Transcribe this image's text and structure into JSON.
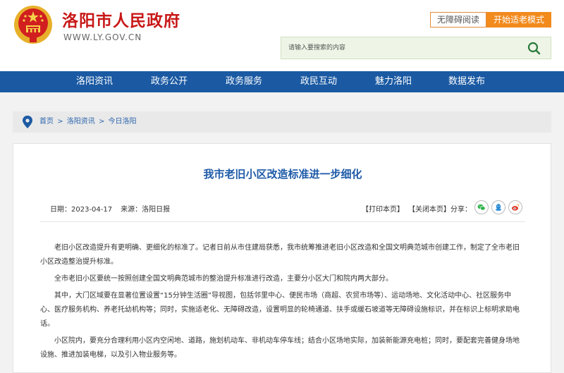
{
  "header": {
    "site_title": "洛阳市人民政府",
    "site_url": "WWW.LY.GOV.CN",
    "accessible_btn": "无障碍阅读",
    "elder_btn": "开始适老模式",
    "search_placeholder": "请输入要搜索的内容"
  },
  "nav": {
    "items": [
      "洛阳资讯",
      "政务公开",
      "政务服务",
      "政民互动",
      "魅力洛阳",
      "数据发布"
    ]
  },
  "breadcrumb": {
    "items": [
      "首页",
      "洛阳资讯",
      "今日洛阳"
    ],
    "separator": ">"
  },
  "article": {
    "title": "我市老旧小区改造标准进一步细化",
    "date": "日期：2023-04-17",
    "source": "来源：洛阳日报",
    "print": "【打印本页】",
    "close": "【关闭本页】",
    "share_label": "分享：",
    "paragraphs": [
      "老旧小区改造提升有更明确、更细化的标准了。记者日前从市住建局获悉，我市统筹推进老旧小区改造和全国文明典范城市创建工作，制定了全市老旧小区改造整治提升标准。",
      "全市老旧小区要统一按照创建全国文明典范城市的整治提升标准进行改造，主要分小区大门和院内两大部分。",
      "其中，大门区域要在显著位置设置“15分钟生活圈”导视图，包括邻里中心、便民市场（商超、农贸市场等）、运动场地、文化活动中心、社区服务中心、医疗服务机构、养老托幼机构等；同时，实施适老化、无障碍改造，设置明显的轮椅通道、扶手或缓石坡道等无障碍设施标识，并在标识上标明求助电话。",
      "小区院内，要充分合理利用小区内空闲地、道路，施划机动车、非机动车停车线；结合小区场地实际，加装新能源充电桩；同时，要配套完善健身场地设施、推进加装电梯，以及引入物业服务等。"
    ]
  },
  "colors": {
    "brand_red": "#c81818",
    "nav_blue": "#1b5aa3",
    "link_blue": "#2b64ad",
    "accent_orange": "#f28a1c",
    "search_bg": "#eef5e6"
  },
  "icons": {
    "emblem": "national-emblem-icon",
    "search": "search-icon",
    "location": "location-pin-icon",
    "share": [
      "wechat-icon",
      "qq-icon",
      "weibo-icon"
    ]
  }
}
